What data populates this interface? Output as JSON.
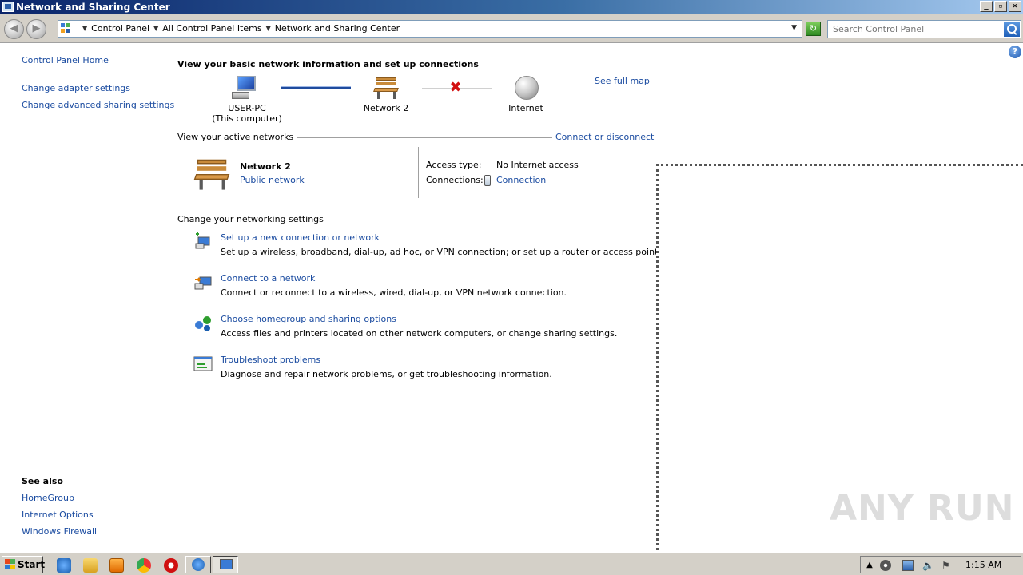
{
  "window": {
    "title": "Network and Sharing Center",
    "buttons": {
      "minimize": "_",
      "maximize": "▫",
      "close": "×"
    }
  },
  "address": {
    "crumbs": [
      "Control Panel",
      "All Control Panel Items",
      "Network and Sharing Center"
    ]
  },
  "search": {
    "placeholder": "Search Control Panel"
  },
  "sidebar": {
    "home": "Control Panel Home",
    "links": [
      "Change adapter settings",
      "Change advanced sharing settings"
    ],
    "see_also_heading": "See also",
    "see_also": [
      "HomeGroup",
      "Internet Options",
      "Windows Firewall"
    ]
  },
  "main": {
    "title": "View your basic network information and set up connections",
    "see_full_map": "See full map",
    "map": {
      "computer_name": "USER-PC",
      "computer_sub": "(This computer)",
      "network_name": "Network  2",
      "internet": "Internet"
    },
    "active_networks_label": "View your active networks",
    "connect_or_disconnect": "Connect or disconnect",
    "active_network": {
      "name": "Network  2",
      "type": "Public network",
      "access_type_label": "Access type:",
      "access_type_value": "No Internet access",
      "connections_label": "Connections:",
      "connections_value": "Connection"
    },
    "settings_label": "Change your networking settings",
    "tasks": [
      {
        "title": "Set up a new connection or network",
        "desc": "Set up a wireless, broadband, dial-up, ad hoc, or VPN connection; or set up a router or access point."
      },
      {
        "title": "Connect to a network",
        "desc": "Connect or reconnect to a wireless, wired, dial-up, or VPN network connection."
      },
      {
        "title": "Choose homegroup and sharing options",
        "desc": "Access files and printers located on other network computers, or change sharing settings."
      },
      {
        "title": "Troubleshoot problems",
        "desc": "Diagnose and repair network problems, or get troubleshooting information."
      }
    ]
  },
  "watermark": "ANY RUN",
  "taskbar": {
    "start_label": "Start",
    "clock": "1:15 AM"
  },
  "colors": {
    "link": "#1a4ba0",
    "titlebar_start": "#0a246a",
    "taskbar": "#d4d0c8"
  }
}
